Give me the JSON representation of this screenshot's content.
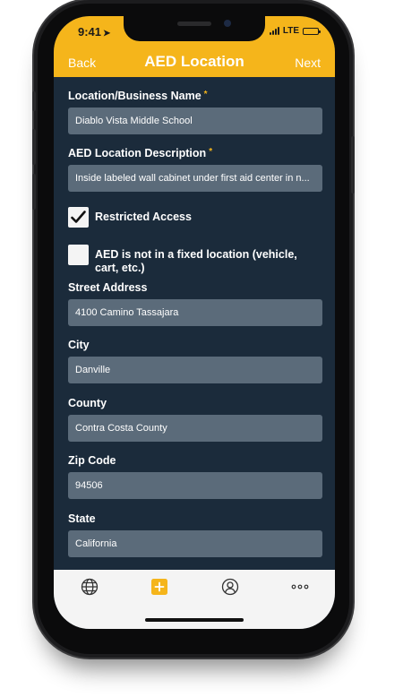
{
  "status_bar": {
    "time": "9:41",
    "network": "LTE"
  },
  "nav": {
    "back_label": "Back",
    "title": "AED Location",
    "next_label": "Next"
  },
  "form": {
    "business_name": {
      "label": "Location/Business Name",
      "required_mark": "*",
      "value": "Diablo Vista Middle School"
    },
    "description": {
      "label": "AED Location Description",
      "required_mark": "*",
      "value": "Inside labeled wall cabinet under first aid center in n..."
    },
    "restricted_access": {
      "label": "Restricted Access",
      "checked": true
    },
    "not_fixed": {
      "label": "AED is not in a fixed location (vehicle, cart, etc.)",
      "checked": false
    },
    "street": {
      "label": "Street Address",
      "value": "4100 Camino Tassajara"
    },
    "city": {
      "label": "City",
      "value": "Danville"
    },
    "county": {
      "label": "County",
      "value": "Contra Costa County"
    },
    "zip": {
      "label": "Zip Code",
      "value": "94506"
    },
    "state": {
      "label": "State",
      "value": "California"
    }
  },
  "tabbar": {
    "items": [
      {
        "icon": "globe-icon",
        "active": false
      },
      {
        "icon": "add-icon",
        "active": true
      },
      {
        "icon": "user-icon",
        "active": false
      },
      {
        "icon": "more-icon",
        "active": false
      }
    ]
  },
  "colors": {
    "accent": "#f5b51b",
    "background": "#1b2b3b",
    "field": "#5b6b7a",
    "tabbar": "#f4f4f4"
  }
}
